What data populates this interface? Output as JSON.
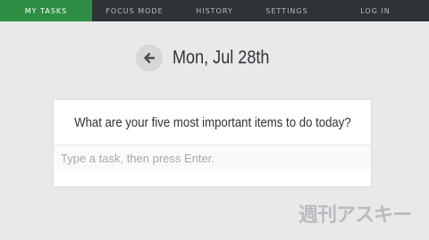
{
  "nav": {
    "items": [
      {
        "label": "MY TASKS",
        "active": true
      },
      {
        "label": "FOCUS MODE",
        "active": false
      },
      {
        "label": "HISTORY",
        "active": false
      },
      {
        "label": "SETTINGS",
        "active": false
      },
      {
        "label": "LOG IN",
        "active": false
      }
    ],
    "accent_color": "#2e8f44",
    "background_color": "#2f3336"
  },
  "header": {
    "back_icon": "arrow-left-icon",
    "date": "Mon, Jul 28th"
  },
  "card": {
    "question": "What are your five most important items to do today?",
    "input_placeholder": "Type a task, then press Enter.",
    "input_value": ""
  },
  "watermark": {
    "text": "週刊アスキー"
  }
}
